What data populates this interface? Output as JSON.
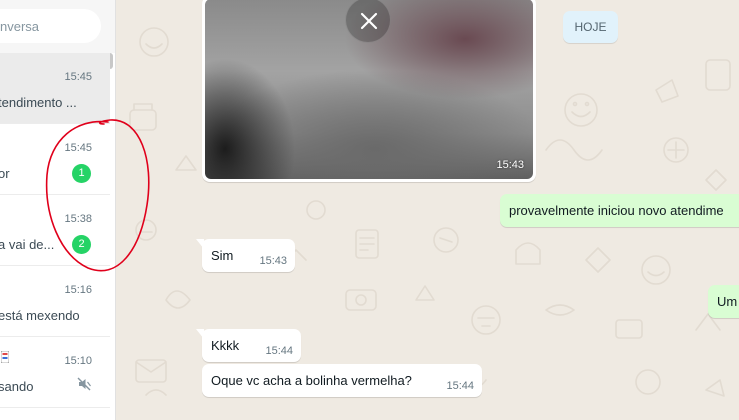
{
  "search": {
    "placeholder": "nversa"
  },
  "chats": [
    {
      "time": "15:45",
      "preview": "tendimento ...",
      "unread": "",
      "active": true
    },
    {
      "time": "15:45",
      "preview": "or",
      "unread": "1",
      "active": false
    },
    {
      "time": "15:38",
      "preview": "a  vai de...",
      "unread": "2",
      "active": false
    },
    {
      "time": "15:16",
      "preview": "está mexendo",
      "unread": "",
      "active": false
    },
    {
      "time": "15:10",
      "preview": "sando",
      "unread": "",
      "active": false,
      "muted": true
    }
  ],
  "conversation": {
    "media": {
      "time": "15:43",
      "close_icon": "close-icon"
    },
    "date_chip": "HOJE",
    "messages": [
      {
        "direction": "out",
        "text": "provavelmente iniciou novo atendime",
        "time": ""
      },
      {
        "direction": "in",
        "text": "Sim",
        "time": "15:43"
      },
      {
        "direction": "out",
        "text": "Um",
        "time": ""
      },
      {
        "direction": "in",
        "text": "Kkkk",
        "time": "15:44"
      },
      {
        "direction": "in",
        "text": "Oque vc acha a bolinha vermelha?",
        "time": "15:44"
      }
    ]
  },
  "colors": {
    "unread_badge": "#25d366",
    "outgoing_bubble": "#d9fdd3",
    "incoming_bubble": "#ffffff",
    "chat_background": "#efeae2",
    "date_chip": "#e1f2fb",
    "annotation": "#e0001b"
  }
}
